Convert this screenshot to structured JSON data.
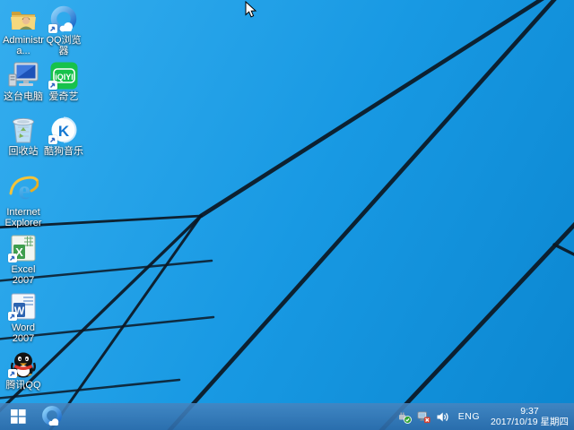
{
  "wallpaper": {
    "base_top_left": "#34adee",
    "base_bottom_right": "#0b86d0",
    "beam_color": "#0c1824"
  },
  "desktop": {
    "icons": [
      {
        "name": "administrator-folder",
        "label": "Administra..."
      },
      {
        "name": "this-pc",
        "label": "这台电脑"
      },
      {
        "name": "recycle-bin",
        "label": "回收站"
      },
      {
        "name": "internet-explorer",
        "label": "Internet Explorer",
        "icon_text": "e"
      },
      {
        "name": "excel-2007",
        "label": "Excel 2007",
        "icon_text": "X"
      },
      {
        "name": "word-2007",
        "label": "Word 2007",
        "icon_text": "W"
      },
      {
        "name": "tencent-qq",
        "label": "腾讯QQ"
      },
      {
        "name": "qq-browser",
        "label": "QQ浏览器"
      },
      {
        "name": "iqiyi",
        "label": "爱奇艺",
        "icon_text": "iQIYI"
      },
      {
        "name": "kugou-music",
        "label": "酷狗音乐",
        "icon_text": "K"
      }
    ]
  },
  "taskbar": {
    "color": "#3b7fbe",
    "language_indicator": "ENG",
    "clock": {
      "time": "9:37",
      "date": "2017/10/19 星期四"
    },
    "tray_icons": [
      "safely-remove-hardware",
      "network-disconnected",
      "volume"
    ]
  }
}
